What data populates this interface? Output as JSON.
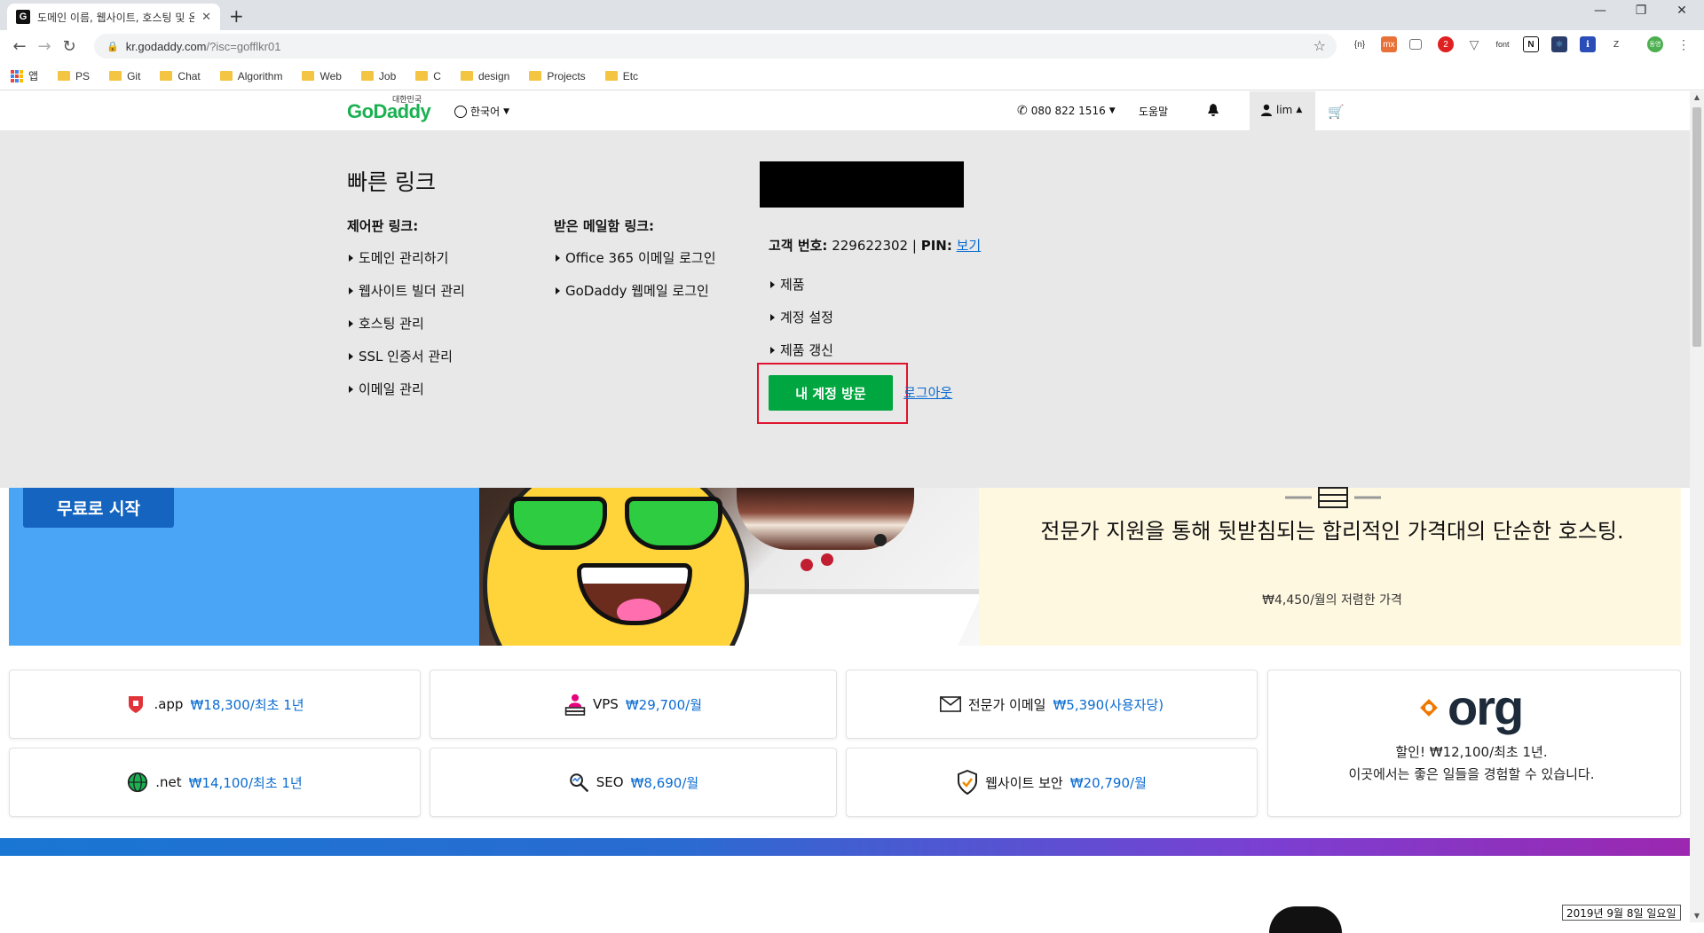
{
  "browser": {
    "tab_title": "도메인 이름, 웹사이트, 호스팅 및 온라인 마케팅 도구 - GoDaddy KR",
    "tab_favicon": "G",
    "new_tab": "+",
    "url_host": "kr.godaddy.com",
    "url_path": "/?isc=gofflkr01",
    "bookmarks": [
      "앱",
      "PS",
      "Git",
      "Chat",
      "Algorithm",
      "Web",
      "Job",
      "C",
      "design",
      "Projects",
      "Etc"
    ],
    "extensions": [
      "{n}",
      "mx",
      "font",
      "N",
      "Z"
    ],
    "ext_badge": "2",
    "profile_label": "동영"
  },
  "header": {
    "logo": "GoDaddy",
    "logo_region": "대한민국",
    "language": "한국어",
    "phone": "080 822 1516",
    "help": "도움말",
    "user": "lim"
  },
  "panel": {
    "title": "빠른 링크",
    "control_title": "제어판 링크:",
    "control_links": [
      "도메인 관리하기",
      "웹사이트 빌더 관리",
      "호스팅 관리",
      "SSL 인증서 관리",
      "이메일 관리"
    ],
    "mail_title": "받은 메일함 링크:",
    "mail_links": [
      "Office 365 이메일 로그인",
      "GoDaddy 웹메일 로그인"
    ],
    "customer_label": "고객 번호:",
    "customer_number": "229622302",
    "pin_label": "PIN:",
    "pin_link": "보기",
    "account_links": [
      "제품",
      "계정 설정",
      "제품 갱신"
    ],
    "visit_button": "내 계정 방문",
    "logout": "로그아웃"
  },
  "hero": {
    "start_button": "무료로 시작",
    "hosting_title": "전문가 지원을 통해 뒷받침되는 합리적인 가격대의 단순한 호스팅.",
    "hosting_price": "₩4,450/월의 저렴한 가격"
  },
  "products": [
    {
      "name": ".app",
      "price": "₩18,300/최초 1년",
      "icon": "shield-icon"
    },
    {
      "name": "VPS",
      "price": "₩29,700/월",
      "icon": "server-user-icon"
    },
    {
      "name": "전문가 이메일",
      "price": "₩5,390(사용자당)",
      "icon": "envelope-icon"
    },
    {
      "name": ".net",
      "price": "₩14,100/최초 1년",
      "icon": "globe-icon"
    },
    {
      "name": "SEO",
      "price": "₩8,690/월",
      "icon": "magnifier-icon"
    },
    {
      "name": "웹사이트 보안",
      "price": "₩20,790/월",
      "icon": "security-shield-icon"
    }
  ],
  "org_promo": {
    "logo": "org",
    "line1": "할인! ₩12,100/최초 1년.",
    "line2": "이곳에서는 좋은 일들을 경험할 수 있습니다."
  },
  "taskbar": {
    "date": "2019년 9월 8일 일요일"
  },
  "colors": {
    "brand_green": "#1bb152",
    "button_green": "#00a63f",
    "link_blue": "#0a6bd1",
    "highlight_red": "#e0142e",
    "hero_blue": "#4aa5f6"
  }
}
